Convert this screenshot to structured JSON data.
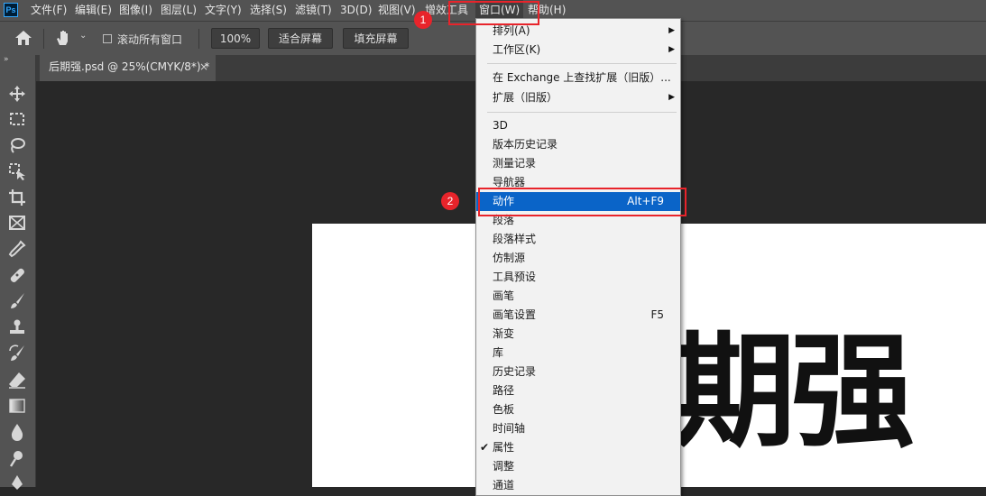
{
  "app": {
    "logo": "Ps"
  },
  "menubar": {
    "items": [
      "文件(F)",
      "编辑(E)",
      "图像(I)",
      "图层(L)",
      "文字(Y)",
      "选择(S)",
      "滤镜(T)",
      "3D(D)",
      "视图(V)",
      "增效工具",
      "窗口(W)",
      "帮助(H)"
    ],
    "active": "窗口(W)"
  },
  "options": {
    "scroll_all_label": "滚动所有窗口",
    "zoom_value": "100%",
    "fit_screen": "适合屏幕",
    "fill_screen": "填充屏幕"
  },
  "document_tab": {
    "title": "后期强.psd @ 25%(CMYK/8*) *",
    "close": "×"
  },
  "tools_collapse": "»",
  "canvas": {
    "text": "期强"
  },
  "window_menu": {
    "items": [
      {
        "label": "排列(A)",
        "submenu": true
      },
      {
        "label": "工作区(K)",
        "submenu": true
      },
      {
        "label": "在 Exchange 上查找扩展（旧版）..."
      },
      {
        "label": "扩展（旧版）",
        "submenu": true
      },
      {
        "label": "3D"
      },
      {
        "label": "版本历史记录"
      },
      {
        "label": "测量记录"
      },
      {
        "label": "导航器"
      },
      {
        "label": "动作",
        "shortcut": "Alt+F9",
        "highlighted": true
      },
      {
        "label": "段落"
      },
      {
        "label": "段落样式"
      },
      {
        "label": "仿制源"
      },
      {
        "label": "工具预设"
      },
      {
        "label": "画笔"
      },
      {
        "label": "画笔设置",
        "shortcut": "F5"
      },
      {
        "label": "渐变"
      },
      {
        "label": "库"
      },
      {
        "label": "历史记录"
      },
      {
        "label": "路径"
      },
      {
        "label": "色板"
      },
      {
        "label": "时间轴"
      },
      {
        "label": "属性",
        "checked": true
      },
      {
        "label": "调整"
      },
      {
        "label": "通道"
      }
    ]
  },
  "annotations": {
    "step1": "1",
    "step2": "2"
  },
  "colors": {
    "highlight": "#0a64c8",
    "annotation": "#e8242b",
    "ui_gray": "#535353"
  }
}
